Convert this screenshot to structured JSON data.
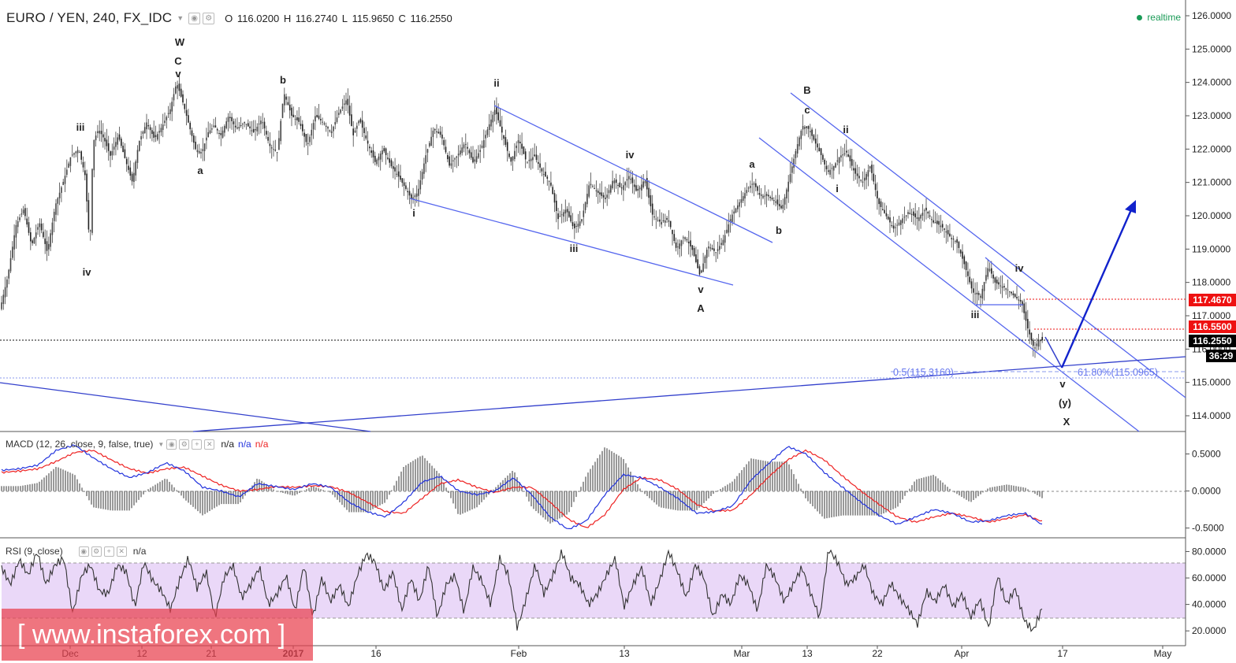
{
  "header": {
    "symbol": "EURO / YEN, 240, FX_IDC",
    "open_label": "O",
    "open": "116.0200",
    "high_label": "H",
    "high": "116.2740",
    "low_label": "L",
    "low": "115.9650",
    "close_label": "C",
    "close": "116.2550",
    "realtime": "realtime"
  },
  "macd_title": {
    "name": "MACD (12, 26, close, 9, false, true)",
    "values": [
      "n/a",
      "n/a",
      "n/a"
    ]
  },
  "rsi_title": {
    "name": "RSI (9, close)",
    "value": "n/a"
  },
  "watermark": "[ www.instaforex.com ]",
  "colors": {
    "bull": "#555555",
    "macd": "#2233dd",
    "signal": "#ee2222",
    "lines": "#4455dd",
    "red_tag": "#ee1111",
    "rsi_band": "#ead8f8",
    "rsi_line": "#333333"
  },
  "chart_data": [
    {
      "type": "candlestick",
      "title": "EURO / YEN, 240, FX_IDC",
      "y_range": [
        113.5,
        126.2
      ],
      "y_ticks": [
        "126.0000",
        "125.0000",
        "124.0000",
        "123.0000",
        "122.0000",
        "121.0000",
        "120.0000",
        "119.0000",
        "118.0000",
        "117.0000",
        "116.0000",
        "115.0000",
        "114.0000"
      ],
      "x_ticks": [
        "Dec",
        "12",
        "21",
        "2017",
        "16",
        "Feb",
        "13",
        "Mar",
        "13",
        "22",
        "Apr",
        "17",
        "May"
      ],
      "price_tags": [
        {
          "value": "117.4670",
          "color": "#ee1111"
        },
        {
          "value": "116.5500",
          "color": "#ee1111"
        },
        {
          "value": "116.2550",
          "color": "#000000"
        },
        {
          "value": "36:29",
          "color": "#000000"
        }
      ],
      "swing_path": [
        [
          0,
          117.2
        ],
        [
          10,
          118.2
        ],
        [
          20,
          119.7
        ],
        [
          30,
          120.2
        ],
        [
          40,
          119.1
        ],
        [
          50,
          119.8
        ],
        [
          60,
          118.9
        ],
        [
          70,
          120.3
        ],
        [
          80,
          121.0
        ],
        [
          90,
          121.8
        ],
        [
          100,
          122.0
        ],
        [
          108,
          121.2
        ],
        [
          114,
          119.0
        ],
        [
          118,
          122.2
        ],
        [
          125,
          122.6
        ],
        [
          132,
          122.3
        ],
        [
          140,
          121.8
        ],
        [
          150,
          122.4
        ],
        [
          160,
          121.6
        ],
        [
          168,
          121.0
        ],
        [
          176,
          122.2
        ],
        [
          186,
          122.8
        ],
        [
          196,
          122.3
        ],
        [
          206,
          122.7
        ],
        [
          216,
          123.2
        ],
        [
          224,
          124.0
        ],
        [
          232,
          123.4
        ],
        [
          240,
          122.7
        ],
        [
          248,
          122.0
        ],
        [
          256,
          121.9
        ],
        [
          264,
          122.5
        ],
        [
          272,
          122.7
        ],
        [
          280,
          122.4
        ],
        [
          290,
          123.0
        ],
        [
          300,
          122.6
        ],
        [
          310,
          122.8
        ],
        [
          322,
          122.5
        ],
        [
          332,
          122.9
        ],
        [
          342,
          122.1
        ],
        [
          352,
          121.9
        ],
        [
          360,
          123.7
        ],
        [
          370,
          123.0
        ],
        [
          380,
          122.8
        ],
        [
          390,
          122.1
        ],
        [
          400,
          123.0
        ],
        [
          410,
          122.8
        ],
        [
          420,
          122.5
        ],
        [
          430,
          123.1
        ],
        [
          440,
          123.5
        ],
        [
          448,
          122.4
        ],
        [
          456,
          122.9
        ],
        [
          466,
          122.2
        ],
        [
          476,
          121.6
        ],
        [
          486,
          122.0
        ],
        [
          496,
          121.5
        ],
        [
          505,
          121.2
        ],
        [
          515,
          120.8
        ],
        [
          522,
          120.5
        ],
        [
          530,
          120.7
        ],
        [
          540,
          121.8
        ],
        [
          550,
          122.6
        ],
        [
          560,
          122.4
        ],
        [
          570,
          121.5
        ],
        [
          580,
          121.8
        ],
        [
          590,
          122.2
        ],
        [
          600,
          121.6
        ],
        [
          610,
          122.0
        ],
        [
          620,
          122.7
        ],
        [
          628,
          123.2
        ],
        [
          638,
          122.4
        ],
        [
          648,
          121.6
        ],
        [
          658,
          122.3
        ],
        [
          668,
          121.6
        ],
        [
          678,
          121.8
        ],
        [
          688,
          121.3
        ],
        [
          698,
          121.0
        ],
        [
          708,
          119.9
        ],
        [
          718,
          120.2
        ],
        [
          728,
          119.6
        ],
        [
          738,
          119.9
        ],
        [
          748,
          121.0
        ],
        [
          758,
          120.7
        ],
        [
          768,
          120.5
        ],
        [
          778,
          121.1
        ],
        [
          788,
          120.8
        ],
        [
          798,
          121.2
        ],
        [
          808,
          120.7
        ],
        [
          818,
          121.1
        ],
        [
          828,
          120.0
        ],
        [
          838,
          119.8
        ],
        [
          848,
          119.9
        ],
        [
          858,
          119.0
        ],
        [
          868,
          119.4
        ],
        [
          878,
          119.0
        ],
        [
          888,
          118.2
        ],
        [
          898,
          119.1
        ],
        [
          908,
          118.9
        ],
        [
          918,
          119.3
        ],
        [
          928,
          120.0
        ],
        [
          938,
          120.4
        ],
        [
          948,
          120.8
        ],
        [
          956,
          121.0
        ],
        [
          964,
          120.6
        ],
        [
          974,
          120.6
        ],
        [
          984,
          120.4
        ],
        [
          992,
          120.2
        ],
        [
          1002,
          121.2
        ],
        [
          1010,
          122.0
        ],
        [
          1018,
          122.7
        ],
        [
          1026,
          122.6
        ],
        [
          1034,
          122.2
        ],
        [
          1042,
          121.8
        ],
        [
          1050,
          121.3
        ],
        [
          1058,
          121.5
        ],
        [
          1066,
          121.8
        ],
        [
          1074,
          121.9
        ],
        [
          1084,
          121.3
        ],
        [
          1094,
          121.0
        ],
        [
          1104,
          121.5
        ],
        [
          1114,
          120.4
        ],
        [
          1124,
          120.0
        ],
        [
          1134,
          119.6
        ],
        [
          1144,
          119.9
        ],
        [
          1154,
          120.1
        ],
        [
          1164,
          119.9
        ],
        [
          1174,
          120.2
        ],
        [
          1184,
          119.8
        ],
        [
          1194,
          119.7
        ],
        [
          1204,
          119.4
        ],
        [
          1214,
          119.2
        ],
        [
          1224,
          118.5
        ],
        [
          1234,
          117.7
        ],
        [
          1244,
          117.6
        ],
        [
          1254,
          118.5
        ],
        [
          1262,
          118.0
        ],
        [
          1270,
          117.9
        ],
        [
          1278,
          117.8
        ],
        [
          1286,
          117.6
        ],
        [
          1296,
          117.4
        ],
        [
          1304,
          116.6
        ],
        [
          1312,
          116.0
        ],
        [
          1318,
          116.3
        ],
        [
          1324,
          116.25
        ]
      ],
      "wave_labels": [
        "W",
        "C",
        "v",
        "iii",
        "a",
        "iv",
        "b",
        "ii",
        "iv",
        "i",
        "iii",
        "v",
        "A",
        "a",
        "b",
        "B",
        "c",
        "ii",
        "i",
        "iv",
        "iii",
        "v",
        "(y)",
        "X"
      ],
      "fib_labels": [
        "0.5(115.3160)",
        "61.80%(115.0965)"
      ]
    },
    {
      "type": "line",
      "title": "MACD (12, 26, close, 9, false, true)",
      "y_range": [
        -0.6,
        0.75
      ],
      "y_ticks": [
        "0.5000",
        "0.0000",
        "-0.5000"
      ],
      "series": [
        {
          "name": "MACD",
          "values": [
            0.28,
            0.3,
            0.35,
            0.55,
            0.62,
            0.45,
            0.3,
            0.18,
            0.25,
            0.38,
            0.27,
            0.05,
            0.0,
            -0.08,
            0.1,
            0.06,
            0.02,
            0.1,
            0.05,
            -0.15,
            -0.28,
            -0.35,
            -0.15,
            0.12,
            0.2,
            0.0,
            -0.05,
            0.0,
            0.18,
            -0.05,
            -0.35,
            -0.52,
            -0.4,
            -0.05,
            0.22,
            0.18,
            0.05,
            -0.1,
            -0.3,
            -0.28,
            -0.2,
            0.15,
            0.38,
            0.6,
            0.5,
            0.25,
            0.05,
            -0.15,
            -0.33,
            -0.45,
            -0.35,
            -0.25,
            -0.3,
            -0.42,
            -0.4,
            -0.33,
            -0.3,
            -0.47
          ]
        },
        {
          "name": "Signal",
          "values": [
            0.25,
            0.27,
            0.3,
            0.4,
            0.52,
            0.55,
            0.42,
            0.3,
            0.24,
            0.3,
            0.32,
            0.2,
            0.08,
            0.0,
            0.02,
            0.06,
            0.05,
            0.07,
            0.06,
            -0.02,
            -0.15,
            -0.28,
            -0.3,
            -0.1,
            0.1,
            0.15,
            0.05,
            -0.02,
            0.05,
            0.05,
            -0.15,
            -0.38,
            -0.5,
            -0.32,
            0.02,
            0.18,
            0.15,
            0.02,
            -0.18,
            -0.27,
            -0.26,
            -0.05,
            0.2,
            0.42,
            0.55,
            0.42,
            0.2,
            0.0,
            -0.18,
            -0.35,
            -0.42,
            -0.35,
            -0.3,
            -0.35,
            -0.42,
            -0.37,
            -0.32,
            -0.42
          ]
        }
      ]
    },
    {
      "type": "line",
      "title": "RSI (9, close)",
      "y_range": [
        10,
        88
      ],
      "y_ticks": [
        "80.0000",
        "60.0000",
        "40.0000",
        "20.0000"
      ],
      "band": [
        30,
        70
      ],
      "series": [
        {
          "name": "RSI",
          "values": [
            68,
            55,
            74,
            62,
            80,
            55,
            70,
            75,
            33,
            62,
            70,
            50,
            48,
            70,
            65,
            38,
            72,
            58,
            50,
            36,
            58,
            75,
            52,
            65,
            30,
            60,
            70,
            45,
            55,
            68,
            40,
            48,
            62,
            35,
            70,
            30,
            60,
            42,
            55,
            38,
            62,
            78,
            72,
            50,
            65,
            35,
            60,
            42,
            70,
            30,
            55,
            62,
            34,
            68,
            58,
            40,
            75,
            62,
            22,
            45,
            70,
            48,
            62,
            80,
            60,
            55,
            40,
            48,
            62,
            75,
            38,
            55,
            68,
            40,
            58,
            80,
            65,
            45,
            70,
            60,
            30,
            48,
            40,
            62,
            55,
            35,
            70,
            60,
            42,
            55,
            68,
            48,
            30,
            82,
            72,
            55,
            60,
            70,
            48,
            40,
            56,
            45,
            36,
            25,
            50,
            42,
            55,
            38,
            48,
            30,
            44,
            22,
            62,
            40,
            52,
            28,
            20,
            37
          ]
        }
      ]
    }
  ]
}
